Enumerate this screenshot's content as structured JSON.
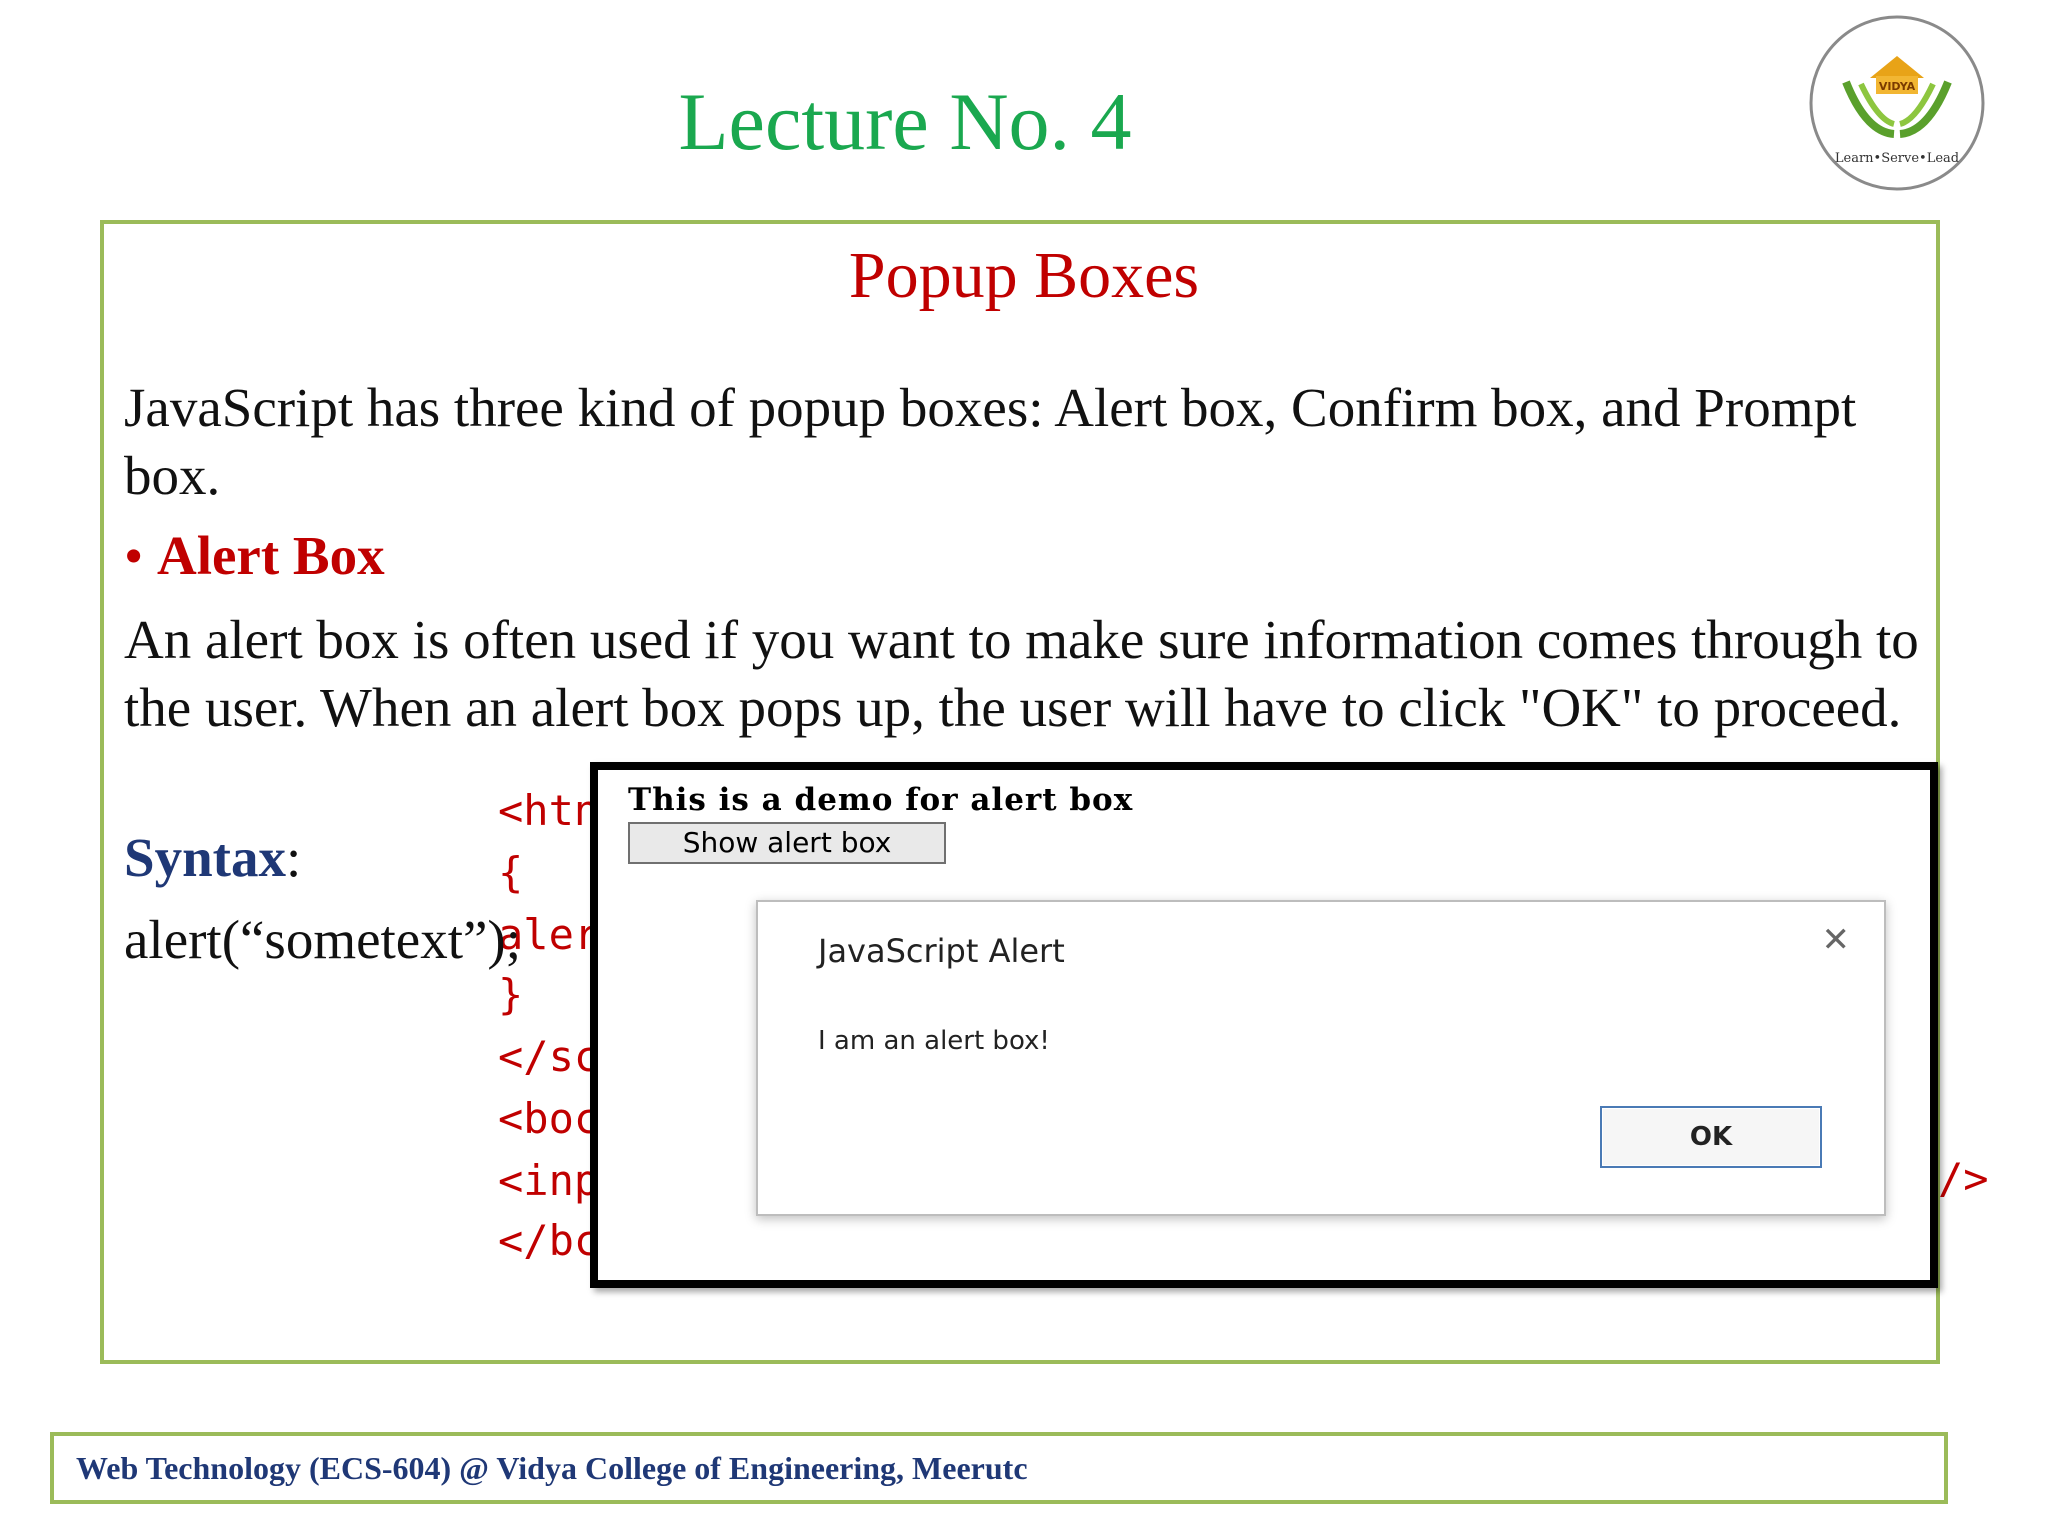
{
  "header": {
    "lecture_title": "Lecture No. 4"
  },
  "logo": {
    "name": "VIDYA",
    "tagline": "Learn•Serve•Lead"
  },
  "slide": {
    "title": "Popup Boxes",
    "intro": "JavaScript has three kind of popup boxes: Alert box, Confirm box, and Prompt box.",
    "bullet_label": "Alert Box",
    "description": "An alert box is often used if you want to make sure information comes through to the user. When an alert box pops up, the user will have to click \"OK\" to proceed.",
    "syntax_label": "Syntax",
    "syntax_colon": ":",
    "syntax_code": "alert(“sometext”);"
  },
  "code_snippet": {
    "lines": [
      "<htn",
      "{",
      "alert",
      "}",
      "</sc",
      "<boc",
      "<inp",
      "</bc"
    ],
    "tail": "/>"
  },
  "screenshot": {
    "heading": "This is a demo for alert box",
    "button_label": "Show alert box",
    "dialog": {
      "title": "JavaScript Alert",
      "message": "I am an alert box!",
      "close_glyph": "✕",
      "ok_label": "OK"
    }
  },
  "footer": {
    "text": "Web Technology (ECS-604) @ Vidya College of Engineering, Meerutc"
  },
  "colors": {
    "lecture_title": "#1aa84f",
    "slide_title": "#c00000",
    "frame": "#9bbb59",
    "footer_text": "#1f3876"
  }
}
